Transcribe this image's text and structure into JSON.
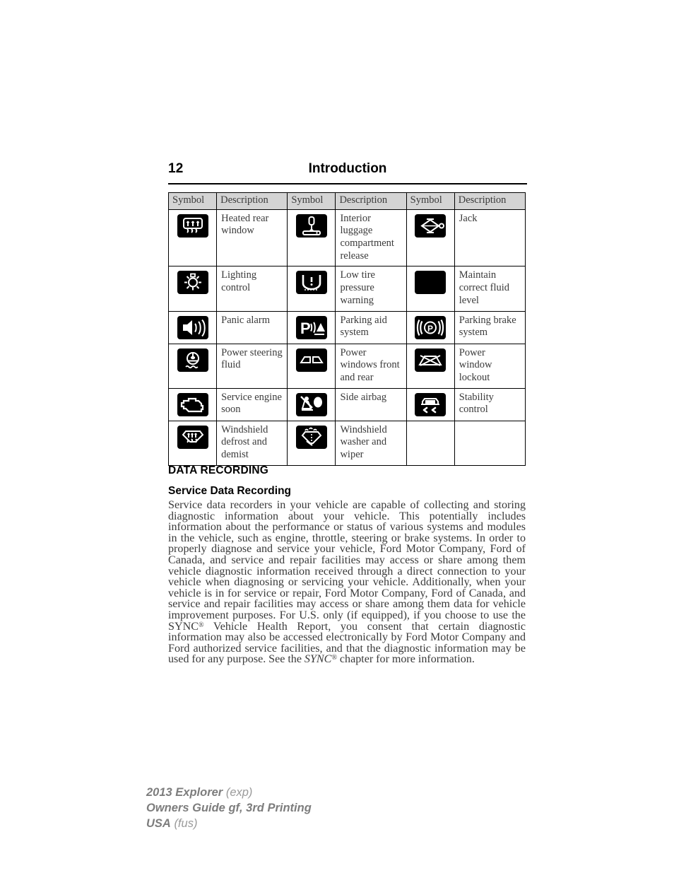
{
  "header": {
    "page_number": "12",
    "title": "Introduction"
  },
  "symbol_table": {
    "columns": [
      "Symbol",
      "Description",
      "Symbol",
      "Description",
      "Symbol",
      "Description"
    ],
    "rows": [
      [
        {
          "icon": "heated-rear-window-icon",
          "label": "Heated rear window"
        },
        {
          "icon": "interior-luggage-compartment-release-icon",
          "label": "Interior luggage compartment release"
        },
        {
          "icon": "jack-icon",
          "label": "Jack"
        }
      ],
      [
        {
          "icon": "lighting-control-icon",
          "label": "Lighting control"
        },
        {
          "icon": "low-tire-pressure-warning-icon",
          "label": "Low tire pressure warning"
        },
        {
          "icon": "maintain-correct-fluid-level-icon",
          "label": "Maintain correct fluid level"
        }
      ],
      [
        {
          "icon": "panic-alarm-icon",
          "label": "Panic alarm"
        },
        {
          "icon": "parking-aid-system-icon",
          "label": "Parking aid system"
        },
        {
          "icon": "parking-brake-system-icon",
          "label": "Parking brake system"
        }
      ],
      [
        {
          "icon": "power-steering-fluid-icon",
          "label": "Power steering fluid"
        },
        {
          "icon": "power-windows-front-and-rear-icon",
          "label": "Power windows front and rear"
        },
        {
          "icon": "power-window-lockout-icon",
          "label": "Power window lockout"
        }
      ],
      [
        {
          "icon": "service-engine-soon-icon",
          "label": "Service engine soon"
        },
        {
          "icon": "side-airbag-icon",
          "label": "Side airbag"
        },
        {
          "icon": "stability-control-icon",
          "label": "Stability control"
        }
      ],
      [
        {
          "icon": "windshield-defrost-and-demist-icon",
          "label": "Windshield defrost and demist"
        },
        {
          "icon": "windshield-washer-and-wiper-icon",
          "label": "Windshield washer and wiper"
        },
        {
          "icon": "",
          "label": ""
        }
      ]
    ]
  },
  "content": {
    "section_heading": "DATA RECORDING",
    "sub_heading": "Service Data Recording",
    "paragraph_part_1": "Service data recorders in your vehicle are capable of collecting and storing diagnostic information about your vehicle. This potentially includes information about the performance or status of various systems and modules in the vehicle, such as engine, throttle, steering or brake systems. In order to properly diagnose and service your vehicle, Ford Motor Company, Ford of Canada, and service and repair facilities may access or share among them vehicle diagnostic information received through a direct connection to your vehicle when diagnosing or servicing your vehicle. Additionally, when your vehicle is in for service or repair, Ford Motor Company, Ford of Canada, and service and repair facilities may access or share among them data for vehicle improvement purposes. For U.S. only (if equipped), if you choose to use the ",
    "sync_mark_1": "SYNC",
    "registered_symbol": "®",
    "paragraph_part_2": " Vehicle Health Report, you consent that certain diagnostic information may also be accessed electronically by Ford Motor Company and Ford authorized service facilities, and that the diagnostic information may be used for any purpose. See the ",
    "sync_mark_2": "SYNC",
    "paragraph_part_3": " chapter for more information."
  },
  "footer": {
    "line1_bold": "2013 Explorer",
    "line1_light": "(exp)",
    "line2_bold": "Owners Guide gf, 3rd Printing",
    "line3_bold": "USA",
    "line3_light": "(fus)"
  }
}
